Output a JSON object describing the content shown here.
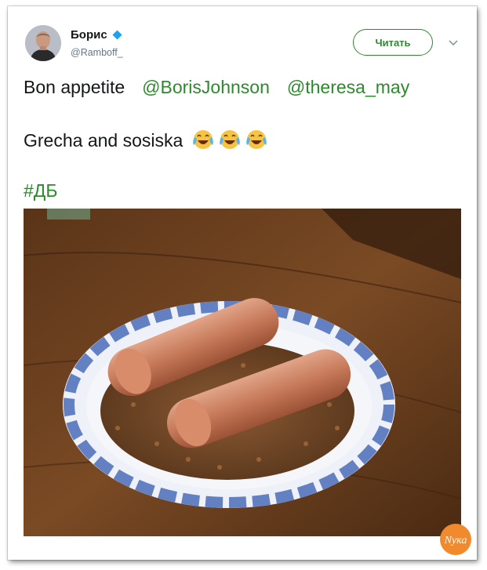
{
  "author": {
    "name": "Борис",
    "handle": "@Ramboff_",
    "verified": true
  },
  "follow_button": {
    "label": "Читать"
  },
  "tweet": {
    "line1_text": "Bon appetite",
    "mentions": [
      "@BorisJohnson",
      "@theresa_may"
    ],
    "line2_text": "Grecha and sosiska",
    "emojis": [
      "face-with-tears-of-joy-icon",
      "face-with-tears-of-joy-icon",
      "face-with-tears-of-joy-icon"
    ],
    "hashtag": "#ДБ"
  },
  "media": {
    "description_icon": "photo-plate-buckwheat-sausages"
  },
  "colors": {
    "link_accent": "#2c8a2c",
    "verified_badge": "#1da1f2",
    "text": "#14171a",
    "secondary_text": "#657786"
  },
  "watermark": {
    "text": "Nука"
  }
}
